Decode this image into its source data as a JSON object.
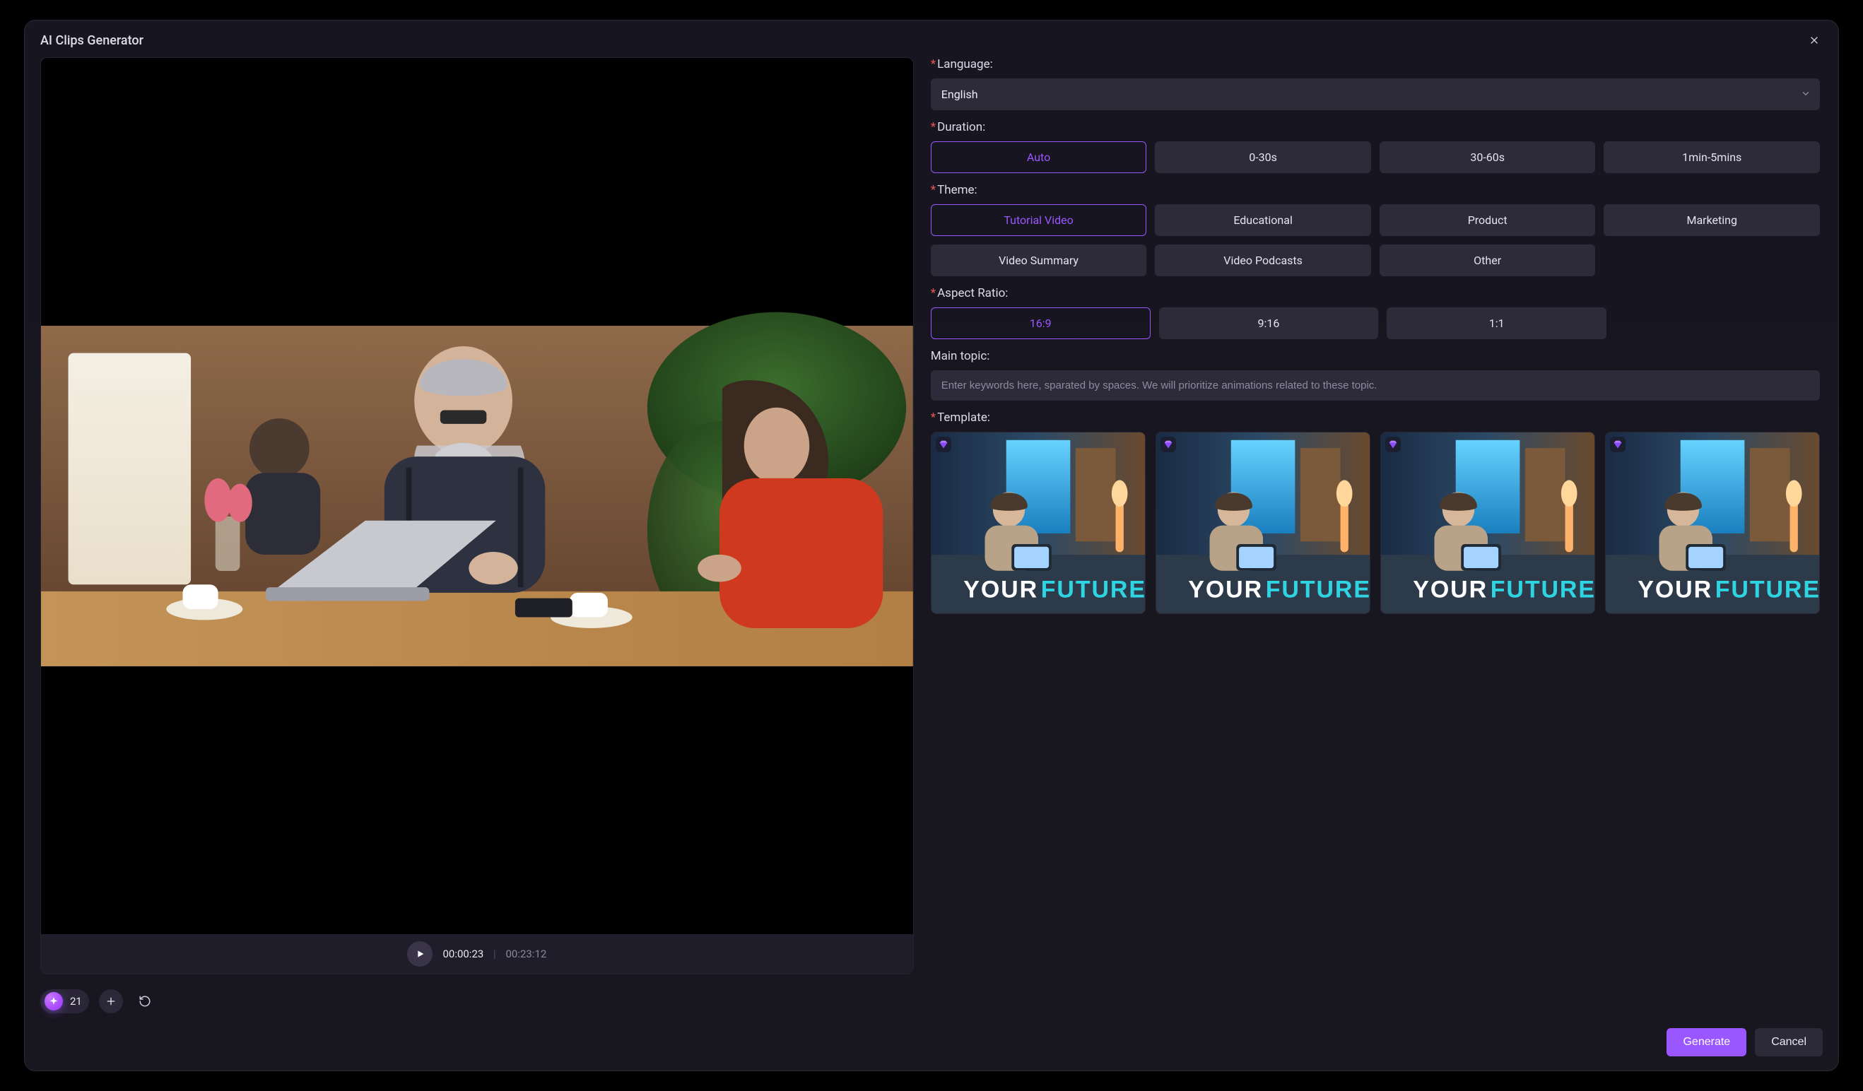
{
  "modal": {
    "title": "AI Clips Generator",
    "close_label": "Close"
  },
  "player": {
    "current_time": "00:00:23",
    "duration": "00:23:12"
  },
  "toolbar": {
    "credits": "21",
    "add_label": "Add",
    "refresh_label": "Refresh"
  },
  "form": {
    "language": {
      "label": "Language:",
      "value": "English"
    },
    "duration": {
      "label": "Duration:",
      "options": [
        "Auto",
        "0-30s",
        "30-60s",
        "1min-5mins"
      ],
      "selected": "Auto"
    },
    "theme": {
      "label": "Theme:",
      "options": [
        "Tutorial Video",
        "Educational",
        "Product",
        "Marketing",
        "Video Summary",
        "Video Podcasts",
        "Other"
      ],
      "selected": "Tutorial Video"
    },
    "aspect": {
      "label": "Aspect Ratio:",
      "options": [
        "16:9",
        "9:16",
        "1:1"
      ],
      "selected": "16:9"
    },
    "topic": {
      "label": "Main topic:",
      "placeholder": "Enter keywords here, sparated by spaces. We will prioritize animations related to these topic.",
      "value": ""
    },
    "template": {
      "label": "Template:",
      "caption_top": "YOUR",
      "caption_bottom": "FUTURE",
      "count": 4
    }
  },
  "buttons": {
    "generate": "Generate",
    "cancel": "Cancel"
  },
  "colors": {
    "accent": "#9a57ff",
    "background": "#17151f"
  }
}
